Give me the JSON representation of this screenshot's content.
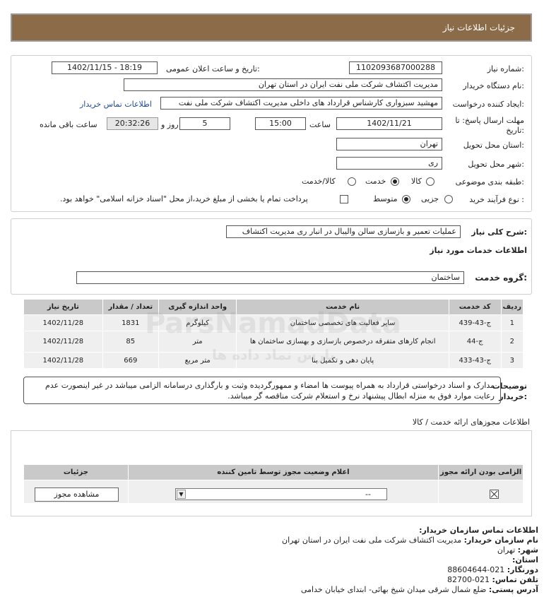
{
  "header": {
    "title": "جزئیات اطلاعات نیاز"
  },
  "form": {
    "need_number_label": "شماره نیاز:",
    "need_number": "1102093687000288",
    "announce_label": "تاریخ و ساعت اعلان عمومی:",
    "announce_value": "1402/11/15 - 18:19",
    "buyer_org_label": "نام دستگاه خریدار:",
    "buyer_org": "مدیریت اکتشاف شرکت ملی نفت ایران در استان تهران",
    "creator_label": "ایجاد کننده درخواست:",
    "creator": "مهشید سبزواری کارشناس قرارداد های داخلی مدیریت اکتشاف شرکت ملی نفت",
    "contact_link": "اطلاعات تماس خریدار",
    "deadline_label_1": "مهلت ارسال پاسخ: تا",
    "deadline_label_2": "تاریخ:",
    "deadline_date": "1402/11/21",
    "time_label": "ساعت",
    "deadline_time": "15:00",
    "days_value": "5",
    "days_label": "روز و",
    "remaining_time": "20:32:26",
    "remaining_label": "ساعت باقی مانده",
    "province_label": "استان محل تحویل:",
    "province": "تهران",
    "city_label": "شهر محل تحویل:",
    "city": "ری",
    "category_label": "طبقه بندی موضوعی:",
    "category_options": [
      "کالا",
      "خدمت",
      "کالا/خدمت"
    ],
    "category_selected": "خدمت",
    "process_label": "نوع فرآیند خرید :",
    "process_options": [
      "جزیی",
      "متوسط"
    ],
    "process_selected": "متوسط",
    "treasury_note": "پرداخت تمام یا بخشی از مبلغ خرید،از محل \"اسناد خزانه اسلامی\" خواهد بود."
  },
  "summary": {
    "general_label": "شرح کلی نیاز:",
    "general_value": "عملیات تعمیر و بازسازی سالن والیبال در انبار ری مدیریت اکتشاف",
    "services_heading": "اطلاعات خدمات مورد نیاز",
    "service_group_label": "گروه خدمت:",
    "service_group": "ساختمان"
  },
  "services_table": {
    "headers": [
      "ردیف",
      "کد خدمت",
      "نام خدمت",
      "واحد اندازه گیری",
      "تعداد / مقدار",
      "تاریخ نیاز"
    ],
    "rows": [
      [
        "1",
        "ج-43-439",
        "سایر فعالیت های تخصصی ساختمان",
        "کیلوگرم",
        "1831",
        "1402/11/28"
      ],
      [
        "2",
        "ج-44",
        "انجام کارهای متفرقه درخصوص بازسازی و بهسازی ساختمان ها",
        "متر",
        "85",
        "1402/11/28"
      ],
      [
        "3",
        "ج-43-433",
        "پایان دهی و تکمیل بنا",
        "متر مربع",
        "669",
        "1402/11/28"
      ]
    ]
  },
  "notes": {
    "label": "توضیحات خریدار:",
    "text": "مدارک و اسناد درخواستی قرارداد به همراه پیوست ها امضاء و ممهورگردیده وثبت و بارگذاری درسامانه الزامی میباشد در غیر اینصورت عدم رعایت موارد فوق به منزله ابطال پیشنهاد نرخ و استعلام شرکت مناقصه گر میباشد."
  },
  "permits": {
    "section_title": "اطلاعات مجوزهای ارائه خدمت / کالا",
    "headers": [
      "الزامی بودن ارائه مجوز",
      "اعلام وضعیت مجوز توسط تامین کننده",
      "جزئیات"
    ],
    "select_value": "--",
    "view_button": "مشاهده مجوز"
  },
  "contact": {
    "title": "اطلاعات تماس سازمان خریدار:",
    "org_label": "نام سازمان خریدار:",
    "org": "مدیریت اکتشاف شرکت ملی نفت ایران در استان تهران",
    "city_label": "شهر:",
    "city": "تهران",
    "province_label": "استان:",
    "fax_label": "دورنگار:",
    "fax": "021-88604644",
    "phone_label": "تلفن تماس:",
    "phone": "021-82700",
    "address_label": "آدرس پستی:",
    "address": "ضلع شمال شرقی میدان شیخ بهائی- ابتدای خیابان خدامی"
  },
  "watermark": {
    "text": "ParsNamadData",
    "sub": "پارس نماد داده ها"
  }
}
